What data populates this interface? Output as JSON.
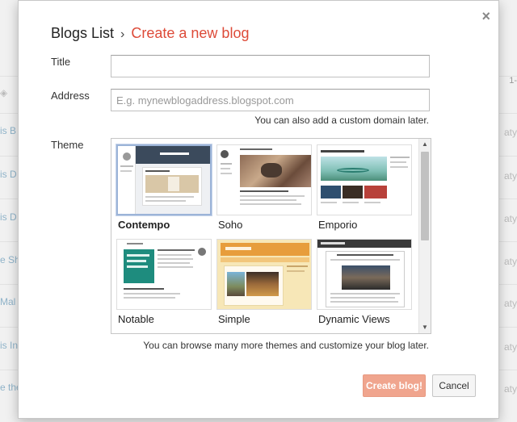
{
  "background": {
    "left_fragments": [
      "is B",
      "is D",
      "is D",
      "e Sh",
      "Mal",
      "is In",
      "e the"
    ],
    "right_fragments": [
      "aty",
      "aty",
      "aty",
      "aty",
      "aty",
      "aty",
      "aty"
    ],
    "corner_number": "1-"
  },
  "dialog": {
    "close_label": "×",
    "breadcrumb": {
      "parent": "Blogs List",
      "separator": "›",
      "current": "Create a new blog"
    },
    "title_label": "Title",
    "title_value": "",
    "address_label": "Address",
    "address_placeholder": "E.g. mynewblogaddress.blogspot.com",
    "address_hint": "You can also add a custom domain later.",
    "theme_label": "Theme",
    "themes": [
      {
        "name": "Contempo"
      },
      {
        "name": "Soho"
      },
      {
        "name": "Emporio"
      },
      {
        "name": "Notable"
      },
      {
        "name": "Simple"
      },
      {
        "name": "Dynamic Views"
      }
    ],
    "selected_theme": "Contempo",
    "themes_hint": "You can browse many more themes and customize your blog later.",
    "create_label": "Create blog!",
    "cancel_label": "Cancel"
  }
}
